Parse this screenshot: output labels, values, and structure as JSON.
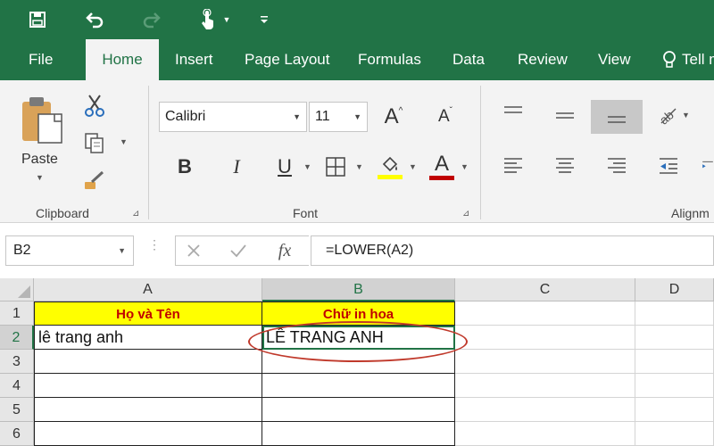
{
  "quick_access": {
    "icons": [
      "save-icon",
      "undo-icon",
      "redo-icon",
      "touch-mode-icon",
      "customize-icon"
    ]
  },
  "tabs": [
    {
      "label": "File"
    },
    {
      "label": "Home"
    },
    {
      "label": "Insert"
    },
    {
      "label": "Page Layout"
    },
    {
      "label": "Formulas"
    },
    {
      "label": "Data"
    },
    {
      "label": "Review"
    },
    {
      "label": "View"
    },
    {
      "label": "Tell m"
    }
  ],
  "active_tab": "Home",
  "ribbon": {
    "clipboard": {
      "paste_label": "Paste",
      "group_label": "Clipboard"
    },
    "font": {
      "family": "Calibri",
      "size": "11",
      "bold": "B",
      "italic": "I",
      "underline": "U",
      "grow": "A",
      "shrink": "A",
      "font_color": "A",
      "group_label": "Font",
      "highlight_color": "#ffff00",
      "text_color": "#c00000"
    },
    "alignment": {
      "group_label": "Alignm"
    }
  },
  "formula_bar": {
    "name_box": "B2",
    "fx_label": "fx",
    "formula": "=LOWER(A2)"
  },
  "sheet": {
    "columns": [
      "A",
      "B",
      "C",
      "D"
    ],
    "rows": [
      "1",
      "2",
      "3",
      "4",
      "5",
      "6"
    ],
    "cells": {
      "A1": "Họ và Tên",
      "B1": "Chữ in hoa",
      "A2": "lê trang anh",
      "B2": "LÊ TRANG ANH"
    },
    "header_fill": "#ffff00",
    "header_text_color": "#c00000",
    "accent": "#217346",
    "annotation_color": "#c0392b"
  }
}
